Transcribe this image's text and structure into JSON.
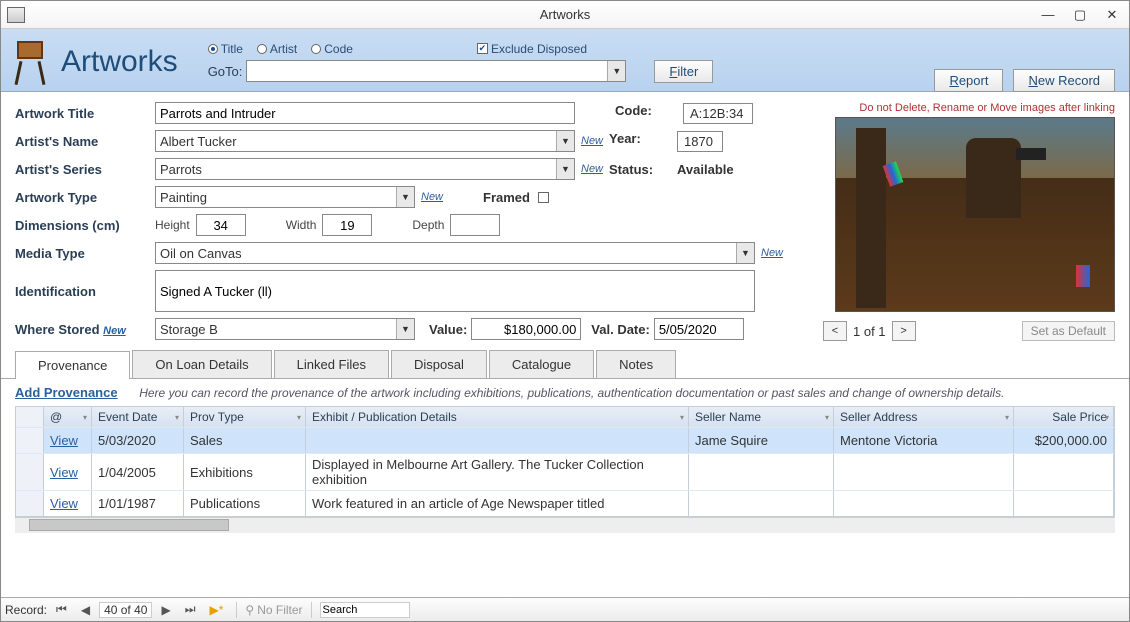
{
  "window": {
    "title": "Artworks"
  },
  "header": {
    "title": "Artworks",
    "goto_label": "GoTo:",
    "radios": {
      "title": "Title",
      "artist": "Artist",
      "code": "Code"
    },
    "exclude_disposed": "Exclude Disposed",
    "filter_btn": "Filter",
    "report_btn": "Report",
    "new_record_btn": "New Record"
  },
  "labels": {
    "artwork_title": "Artwork Title",
    "artist_name": "Artist's Name",
    "artist_series": "Artist's Series",
    "artwork_type": "Artwork Type",
    "framed": "Framed",
    "dimensions": "Dimensions (cm)",
    "height": "Height",
    "width": "Width",
    "depth": "Depth",
    "media_type": "Media Type",
    "identification": "Identification",
    "where_stored": "Where Stored",
    "value": "Value:",
    "val_date": "Val. Date:",
    "new": "New",
    "code": "Code:",
    "year": "Year:",
    "status": "Status:"
  },
  "fields": {
    "title": "Parrots and Intruder",
    "artist": "Albert Tucker",
    "series": "Parrots",
    "type": "Painting",
    "height": "34",
    "width": "19",
    "depth": "",
    "media": "Oil on Canvas",
    "identification": "Signed A Tucker (ll)",
    "stored": "Storage B",
    "value": "$180,000.00",
    "val_date": "5/05/2020",
    "code": "A:12B:34",
    "year": "1870",
    "status": "Available"
  },
  "image": {
    "warning": "Do not Delete, Rename or Move images after linking",
    "pager": {
      "prev": "<",
      "next": ">",
      "text": "1  of  1",
      "default_btn": "Set as Default"
    }
  },
  "tabs": [
    "Provenance",
    "On Loan Details",
    "Linked Files",
    "Disposal",
    "Catalogue",
    "Notes"
  ],
  "prov": {
    "add": "Add Provenance",
    "hint": "Here you can record the provenance of the artwork including exhibitions, publications, authentication documentation or past sales and change of ownership details.",
    "cols": {
      "at": "@",
      "date": "Event Date",
      "type": "Prov Type",
      "details": "Exhibit / Publication Details",
      "seller": "Seller Name",
      "addr": "Seller Address",
      "price": "Sale Price"
    },
    "rows": [
      {
        "view": "View",
        "date": "5/03/2020",
        "type": "Sales",
        "details": "",
        "seller": "Jame Squire",
        "addr": "Mentone Victoria",
        "price": "$200,000.00"
      },
      {
        "view": "View",
        "date": "1/04/2005",
        "type": "Exhibitions",
        "details": "Displayed in Melbourne Art Gallery.  The Tucker Collection exhibition",
        "seller": "",
        "addr": "",
        "price": ""
      },
      {
        "view": "View",
        "date": "1/01/1987",
        "type": "Publications",
        "details": "Work featured in an article of Age Newspaper titled",
        "seller": "",
        "addr": "",
        "price": ""
      }
    ]
  },
  "status": {
    "record_label": "Record:",
    "position": "40 of 40",
    "nofilter": "No Filter",
    "search": "Search"
  }
}
